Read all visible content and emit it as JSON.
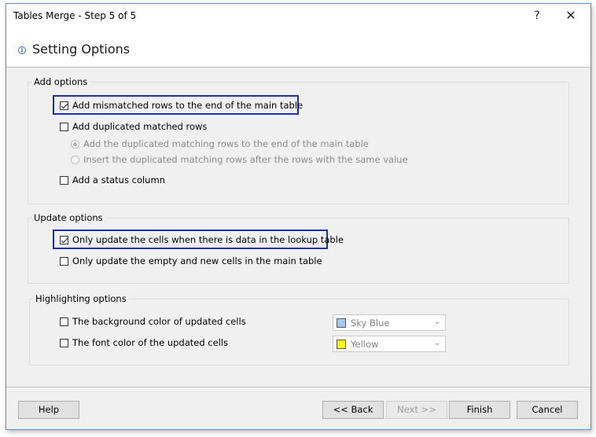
{
  "window": {
    "title": "Tables Merge - Step 5 of 5",
    "help_glyph": "?",
    "close_glyph": "✕"
  },
  "header": {
    "title": "Setting Options",
    "icon": "info-icon"
  },
  "add_options": {
    "legend": "Add options",
    "mismatched": {
      "label": "Add mismatched rows to the end of the main table",
      "checked": true
    },
    "duplicated": {
      "label": "Add duplicated matched rows",
      "checked": false
    },
    "radio_end": {
      "label": "Add the duplicated matching rows to the end of the main table",
      "selected": true,
      "enabled": false
    },
    "radio_after": {
      "label": "Insert the duplicated matching rows after the rows with the same value",
      "selected": false,
      "enabled": false
    },
    "status_column": {
      "label": "Add a status column",
      "checked": false
    }
  },
  "update_options": {
    "legend": "Update options",
    "only_data": {
      "label": "Only update the cells when there is data in the lookup table",
      "checked": true
    },
    "only_empty": {
      "label": "Only update the empty and new cells in the main table",
      "checked": false
    }
  },
  "highlighting_options": {
    "legend": "Highlighting options",
    "bg_color": {
      "label": "The background color of updated cells",
      "checked": false,
      "value": "Sky Blue",
      "swatch": "#a6c8ef"
    },
    "font_color": {
      "label": "The font color of the updated cells",
      "checked": false,
      "value": "Yellow",
      "swatch": "#ffff00"
    }
  },
  "buttons": {
    "help": "Help",
    "back": "<< Back",
    "next": "Next >>",
    "finish": "Finish",
    "cancel": "Cancel"
  },
  "colors": {
    "highlight_border": "#1c2fb4",
    "accent": "#2b6fd1"
  }
}
